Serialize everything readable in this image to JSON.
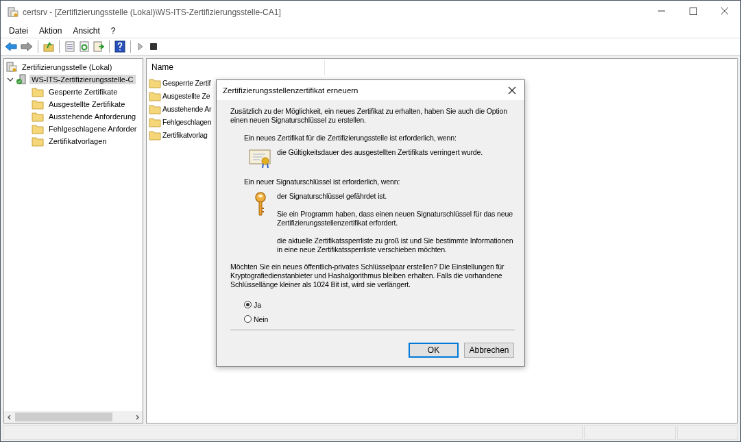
{
  "window": {
    "title": "certsrv - [Zertifizierungsstelle (Lokal)\\WS-ITS-Zertifizierungsstelle-CA1]"
  },
  "menu": [
    "Datei",
    "Aktion",
    "Ansicht",
    "?"
  ],
  "toolbar": [
    {
      "kind": "back"
    },
    {
      "kind": "forward"
    },
    {
      "kind": "sep"
    },
    {
      "kind": "up"
    },
    {
      "kind": "sep"
    },
    {
      "kind": "properties"
    },
    {
      "kind": "refresh"
    },
    {
      "kind": "export"
    },
    {
      "kind": "sep"
    },
    {
      "kind": "help"
    },
    {
      "kind": "sep"
    },
    {
      "kind": "play"
    },
    {
      "kind": "stop"
    }
  ],
  "tree": [
    {
      "label": "Zertifizierungsstelle (Lokal)",
      "selected": false,
      "children": [
        {
          "label": "WS-ITS-Zertifizierungsstelle-C",
          "selected": true,
          "expanded": true,
          "children": [
            {
              "label": "Gesperrte Zertifikate",
              "selected": false
            },
            {
              "label": "Ausgestellte Zertifikate",
              "selected": false
            },
            {
              "label": "Ausstehende Anforderung",
              "selected": false
            },
            {
              "label": "Fehlgeschlagene Anforder",
              "selected": false
            },
            {
              "label": "Zertifikatvorlagen",
              "selected": false
            }
          ]
        }
      ]
    }
  ],
  "list": {
    "column": "Name",
    "items": [
      "Gesperrte Zertif",
      "Ausgestellte Ze",
      "Ausstehende Ar",
      "Fehlgeschlagen",
      "Zertifikatvorlag"
    ]
  },
  "dialog": {
    "title": "Zertifizierungsstellenzertifikat erneuern",
    "intro": "Zusätzlich zu der Möglichkeit, ein neues Zertifikat zu erhalten, haben Sie auch die Option einen neuen Signaturschlüssel zu erstellen.",
    "sections": [
      {
        "heading": "Ein neues Zertifikat für die Zertifizierungsstelle ist erforderlich, wenn:",
        "reasons": [
          "die Gültigkeitsdauer des ausgestellten Zertifikats verringert wurde."
        ]
      },
      {
        "heading": "Ein neuer Signaturschlüssel ist erforderlich, wenn:",
        "reasons": [
          "der Signaturschlüssel gefährdet ist.",
          "Sie ein Programm haben, dass einen neuen Signaturschlüssel für das neue Zertifizierungsstellenzertifikat erfordert.",
          "die aktuelle Zertifikatssperrliste zu groß ist und Sie bestimmte Informationen in eine neue Zertifikatssperrliste verschieben möchten."
        ]
      }
    ],
    "question": "Möchten Sie ein neues öffentlich-privates Schlüsselpaar erstellen? Die Einstellungen für Kryptografiedienstanbieter und Hashalgorithmus bleiben erhalten. Falls die vorhandene Schlüssellänge kleiner als 1024 Bit ist, wird sie verlängert.",
    "options": [
      {
        "label": "Ja",
        "selected": true
      },
      {
        "label": "Nein",
        "selected": false
      }
    ],
    "buttons": [
      {
        "label": "OK",
        "default": true
      },
      {
        "label": "Abbrechen",
        "default": false
      }
    ]
  }
}
